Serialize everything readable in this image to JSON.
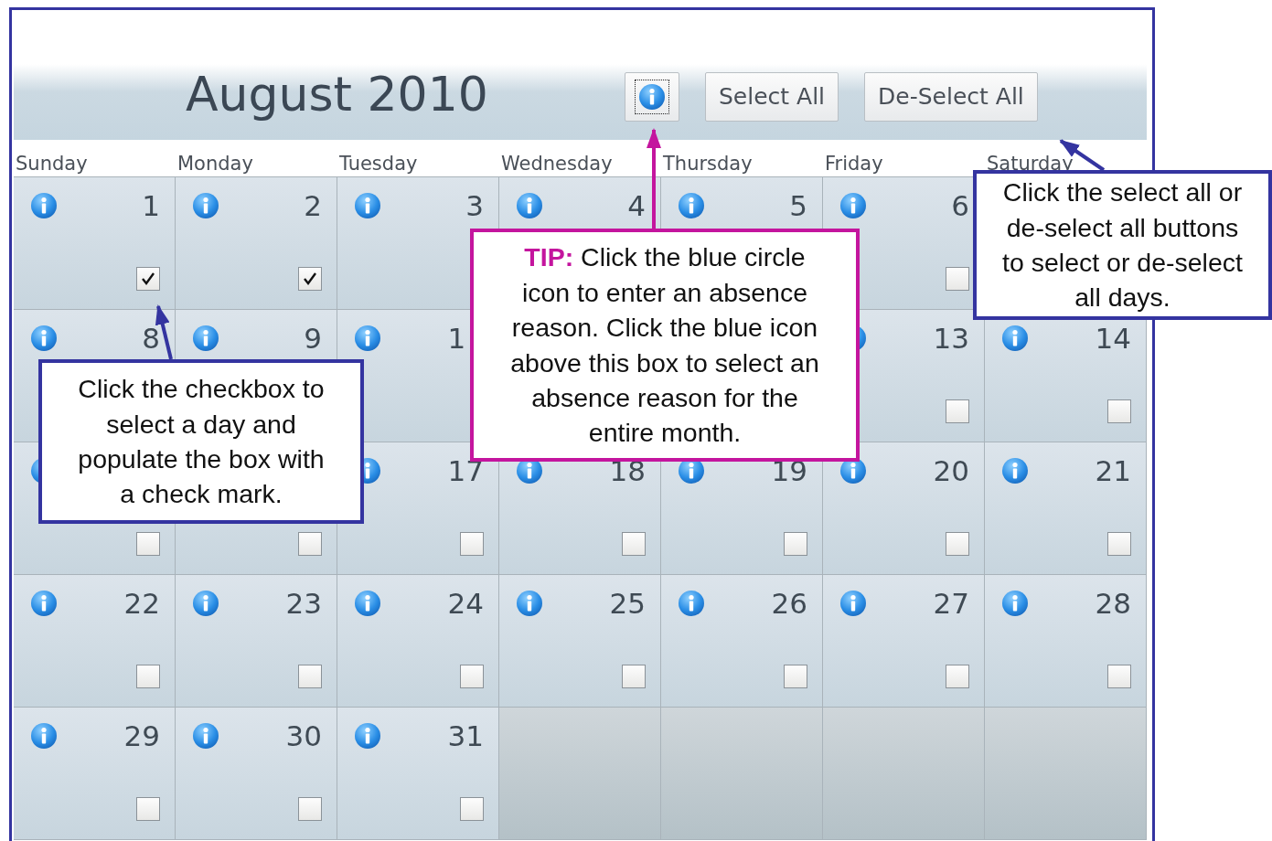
{
  "title": "August 2010",
  "buttons": [
    {
      "kind": "info",
      "focused": true
    },
    {
      "kind": "text",
      "label": "Select All",
      "focused": false
    },
    {
      "kind": "text",
      "label": "De-Select All",
      "focused": false
    }
  ],
  "weekdays": [
    "Sunday",
    "Monday",
    "Tuesday",
    "Wednesday",
    "Thursday",
    "Friday",
    "Saturday"
  ],
  "weeks": [
    {
      "days": [
        {
          "kind": "day",
          "day": "1",
          "checked": true
        },
        {
          "kind": "day",
          "day": "2",
          "checked": true
        },
        {
          "kind": "day",
          "day": "3"
        },
        {
          "kind": "day",
          "day": "4"
        },
        {
          "kind": "day",
          "day": "5"
        },
        {
          "kind": "day",
          "day": "6",
          "checked": false
        },
        {
          "kind": "covered"
        }
      ]
    },
    {
      "days": [
        {
          "kind": "day",
          "day": "8"
        },
        {
          "kind": "day",
          "day": "9"
        },
        {
          "kind": "cut",
          "day": "1"
        },
        {
          "kind": "covered"
        },
        {
          "kind": "covered"
        },
        {
          "kind": "day",
          "day": "13",
          "checked": false
        },
        {
          "kind": "day",
          "day": "14",
          "checked": false
        }
      ]
    },
    {
      "days": [
        {
          "kind": "day",
          "checked": false
        },
        {
          "kind": "lower",
          "checked": false
        },
        {
          "kind": "day",
          "day": "17",
          "checked": false
        },
        {
          "kind": "day",
          "day": "18",
          "checked": false
        },
        {
          "kind": "day",
          "day": "19",
          "checked": false
        },
        {
          "kind": "day",
          "day": "20",
          "checked": false
        },
        {
          "kind": "day",
          "day": "21",
          "checked": false
        }
      ]
    },
    {
      "days": [
        {
          "kind": "day",
          "day": "22",
          "checked": false
        },
        {
          "kind": "day",
          "day": "23",
          "checked": false
        },
        {
          "kind": "day",
          "day": "24",
          "checked": false
        },
        {
          "kind": "day",
          "day": "25",
          "checked": false
        },
        {
          "kind": "day",
          "day": "26",
          "checked": false
        },
        {
          "kind": "day",
          "day": "27",
          "checked": false
        },
        {
          "kind": "day",
          "day": "28",
          "checked": false
        }
      ]
    },
    {
      "days": [
        {
          "kind": "day",
          "day": "29",
          "checked": false
        },
        {
          "kind": "day",
          "day": "30",
          "checked": false
        },
        {
          "kind": "day",
          "day": "31",
          "checked": false
        },
        {
          "kind": "blank"
        },
        {
          "kind": "blank"
        },
        {
          "kind": "blank"
        },
        {
          "kind": "blank"
        }
      ]
    }
  ],
  "callouts": [
    {
      "kind": "tip",
      "text": "**TIP:** Click the blue circle icon to enter an absence reason. Click the blue icon above this box to select an absence reason for the entire month."
    },
    {
      "kind": "note",
      "text": "Click the select all or de-select all buttons to select or de-select all days."
    },
    {
      "kind": "note",
      "text": "Click the checkbox to select a day and populate the box with a check mark."
    }
  ]
}
